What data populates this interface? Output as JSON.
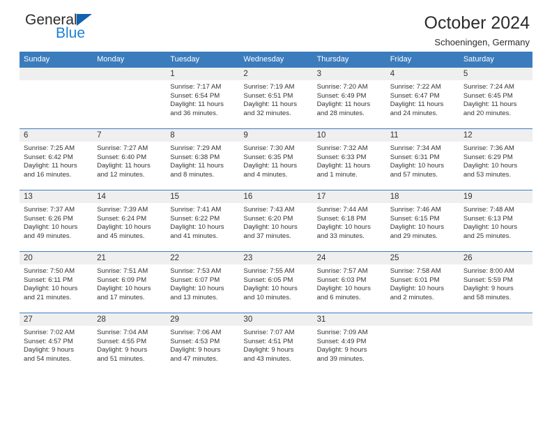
{
  "brand": {
    "name_top": "General",
    "name_bottom": "Blue",
    "triangle_color": "#1262b0",
    "bottom_color": "#1b7fd4"
  },
  "header": {
    "title": "October 2024",
    "subtitle": "Schoeningen, Germany"
  },
  "theme": {
    "header_blue": "#3b7cbd",
    "daynum_band": "#efefef",
    "text": "#333333"
  },
  "weekdays": [
    "Sunday",
    "Monday",
    "Tuesday",
    "Wednesday",
    "Thursday",
    "Friday",
    "Saturday"
  ],
  "labels": {
    "sunrise_prefix": "Sunrise:",
    "sunset_prefix": "Sunset:",
    "daylight_prefix": "Daylight:"
  },
  "weeks": [
    [
      {
        "day": "",
        "empty": true
      },
      {
        "day": "",
        "empty": true
      },
      {
        "day": "1",
        "sunrise": "Sunrise: 7:17 AM",
        "sunset": "Sunset: 6:54 PM",
        "daylight_line1": "Daylight: 11 hours",
        "daylight_line2": "and 36 minutes."
      },
      {
        "day": "2",
        "sunrise": "Sunrise: 7:19 AM",
        "sunset": "Sunset: 6:51 PM",
        "daylight_line1": "Daylight: 11 hours",
        "daylight_line2": "and 32 minutes."
      },
      {
        "day": "3",
        "sunrise": "Sunrise: 7:20 AM",
        "sunset": "Sunset: 6:49 PM",
        "daylight_line1": "Daylight: 11 hours",
        "daylight_line2": "and 28 minutes."
      },
      {
        "day": "4",
        "sunrise": "Sunrise: 7:22 AM",
        "sunset": "Sunset: 6:47 PM",
        "daylight_line1": "Daylight: 11 hours",
        "daylight_line2": "and 24 minutes."
      },
      {
        "day": "5",
        "sunrise": "Sunrise: 7:24 AM",
        "sunset": "Sunset: 6:45 PM",
        "daylight_line1": "Daylight: 11 hours",
        "daylight_line2": "and 20 minutes."
      }
    ],
    [
      {
        "day": "6",
        "sunrise": "Sunrise: 7:25 AM",
        "sunset": "Sunset: 6:42 PM",
        "daylight_line1": "Daylight: 11 hours",
        "daylight_line2": "and 16 minutes."
      },
      {
        "day": "7",
        "sunrise": "Sunrise: 7:27 AM",
        "sunset": "Sunset: 6:40 PM",
        "daylight_line1": "Daylight: 11 hours",
        "daylight_line2": "and 12 minutes."
      },
      {
        "day": "8",
        "sunrise": "Sunrise: 7:29 AM",
        "sunset": "Sunset: 6:38 PM",
        "daylight_line1": "Daylight: 11 hours",
        "daylight_line2": "and 8 minutes."
      },
      {
        "day": "9",
        "sunrise": "Sunrise: 7:30 AM",
        "sunset": "Sunset: 6:35 PM",
        "daylight_line1": "Daylight: 11 hours",
        "daylight_line2": "and 4 minutes."
      },
      {
        "day": "10",
        "sunrise": "Sunrise: 7:32 AM",
        "sunset": "Sunset: 6:33 PM",
        "daylight_line1": "Daylight: 11 hours",
        "daylight_line2": "and 1 minute."
      },
      {
        "day": "11",
        "sunrise": "Sunrise: 7:34 AM",
        "sunset": "Sunset: 6:31 PM",
        "daylight_line1": "Daylight: 10 hours",
        "daylight_line2": "and 57 minutes."
      },
      {
        "day": "12",
        "sunrise": "Sunrise: 7:36 AM",
        "sunset": "Sunset: 6:29 PM",
        "daylight_line1": "Daylight: 10 hours",
        "daylight_line2": "and 53 minutes."
      }
    ],
    [
      {
        "day": "13",
        "sunrise": "Sunrise: 7:37 AM",
        "sunset": "Sunset: 6:26 PM",
        "daylight_line1": "Daylight: 10 hours",
        "daylight_line2": "and 49 minutes."
      },
      {
        "day": "14",
        "sunrise": "Sunrise: 7:39 AM",
        "sunset": "Sunset: 6:24 PM",
        "daylight_line1": "Daylight: 10 hours",
        "daylight_line2": "and 45 minutes."
      },
      {
        "day": "15",
        "sunrise": "Sunrise: 7:41 AM",
        "sunset": "Sunset: 6:22 PM",
        "daylight_line1": "Daylight: 10 hours",
        "daylight_line2": "and 41 minutes."
      },
      {
        "day": "16",
        "sunrise": "Sunrise: 7:43 AM",
        "sunset": "Sunset: 6:20 PM",
        "daylight_line1": "Daylight: 10 hours",
        "daylight_line2": "and 37 minutes."
      },
      {
        "day": "17",
        "sunrise": "Sunrise: 7:44 AM",
        "sunset": "Sunset: 6:18 PM",
        "daylight_line1": "Daylight: 10 hours",
        "daylight_line2": "and 33 minutes."
      },
      {
        "day": "18",
        "sunrise": "Sunrise: 7:46 AM",
        "sunset": "Sunset: 6:15 PM",
        "daylight_line1": "Daylight: 10 hours",
        "daylight_line2": "and 29 minutes."
      },
      {
        "day": "19",
        "sunrise": "Sunrise: 7:48 AM",
        "sunset": "Sunset: 6:13 PM",
        "daylight_line1": "Daylight: 10 hours",
        "daylight_line2": "and 25 minutes."
      }
    ],
    [
      {
        "day": "20",
        "sunrise": "Sunrise: 7:50 AM",
        "sunset": "Sunset: 6:11 PM",
        "daylight_line1": "Daylight: 10 hours",
        "daylight_line2": "and 21 minutes."
      },
      {
        "day": "21",
        "sunrise": "Sunrise: 7:51 AM",
        "sunset": "Sunset: 6:09 PM",
        "daylight_line1": "Daylight: 10 hours",
        "daylight_line2": "and 17 minutes."
      },
      {
        "day": "22",
        "sunrise": "Sunrise: 7:53 AM",
        "sunset": "Sunset: 6:07 PM",
        "daylight_line1": "Daylight: 10 hours",
        "daylight_line2": "and 13 minutes."
      },
      {
        "day": "23",
        "sunrise": "Sunrise: 7:55 AM",
        "sunset": "Sunset: 6:05 PM",
        "daylight_line1": "Daylight: 10 hours",
        "daylight_line2": "and 10 minutes."
      },
      {
        "day": "24",
        "sunrise": "Sunrise: 7:57 AM",
        "sunset": "Sunset: 6:03 PM",
        "daylight_line1": "Daylight: 10 hours",
        "daylight_line2": "and 6 minutes."
      },
      {
        "day": "25",
        "sunrise": "Sunrise: 7:58 AM",
        "sunset": "Sunset: 6:01 PM",
        "daylight_line1": "Daylight: 10 hours",
        "daylight_line2": "and 2 minutes."
      },
      {
        "day": "26",
        "sunrise": "Sunrise: 8:00 AM",
        "sunset": "Sunset: 5:59 PM",
        "daylight_line1": "Daylight: 9 hours",
        "daylight_line2": "and 58 minutes."
      }
    ],
    [
      {
        "day": "27",
        "sunrise": "Sunrise: 7:02 AM",
        "sunset": "Sunset: 4:57 PM",
        "daylight_line1": "Daylight: 9 hours",
        "daylight_line2": "and 54 minutes."
      },
      {
        "day": "28",
        "sunrise": "Sunrise: 7:04 AM",
        "sunset": "Sunset: 4:55 PM",
        "daylight_line1": "Daylight: 9 hours",
        "daylight_line2": "and 51 minutes."
      },
      {
        "day": "29",
        "sunrise": "Sunrise: 7:06 AM",
        "sunset": "Sunset: 4:53 PM",
        "daylight_line1": "Daylight: 9 hours",
        "daylight_line2": "and 47 minutes."
      },
      {
        "day": "30",
        "sunrise": "Sunrise: 7:07 AM",
        "sunset": "Sunset: 4:51 PM",
        "daylight_line1": "Daylight: 9 hours",
        "daylight_line2": "and 43 minutes."
      },
      {
        "day": "31",
        "sunrise": "Sunrise: 7:09 AM",
        "sunset": "Sunset: 4:49 PM",
        "daylight_line1": "Daylight: 9 hours",
        "daylight_line2": "and 39 minutes."
      },
      {
        "day": "",
        "empty": true
      },
      {
        "day": "",
        "empty": true
      }
    ]
  ]
}
